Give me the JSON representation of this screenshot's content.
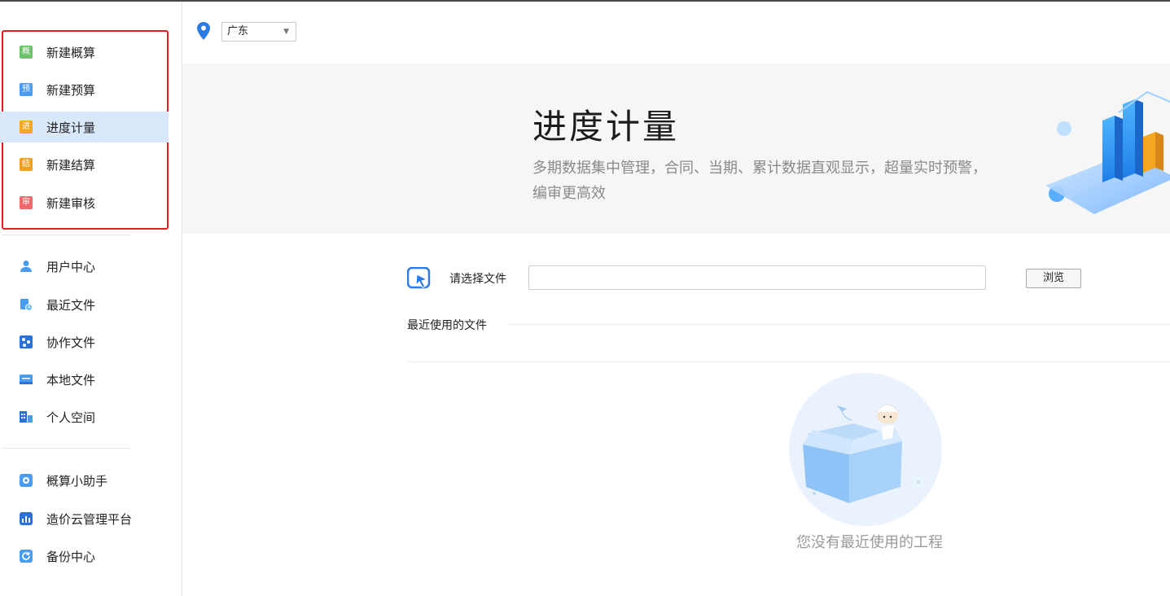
{
  "sidebar": {
    "top_items": [
      {
        "label": "新建概算",
        "icon": "概",
        "icon_name": "estimate-icon",
        "color": "#6cc26b"
      },
      {
        "label": "新建预算",
        "icon": "预",
        "icon_name": "budget-icon",
        "color": "#4a9cf0"
      },
      {
        "label": "进度计量",
        "icon": "进",
        "icon_name": "progress-icon",
        "color": "#f5a623",
        "active": true
      },
      {
        "label": "新建结算",
        "icon": "结",
        "icon_name": "settlement-icon",
        "color": "#f0a020"
      },
      {
        "label": "新建审核",
        "icon": "审",
        "icon_name": "audit-icon",
        "color": "#f06a6a"
      }
    ],
    "mid_items": [
      {
        "label": "用户中心",
        "icon_name": "user-icon"
      },
      {
        "label": "最近文件",
        "icon_name": "recent-files-icon"
      },
      {
        "label": "协作文件",
        "icon_name": "collab-files-icon"
      },
      {
        "label": "本地文件",
        "icon_name": "local-files-icon"
      },
      {
        "label": "个人空间",
        "icon_name": "personal-space-icon"
      }
    ],
    "bottom_items": [
      {
        "label": "概算小助手",
        "icon_name": "assistant-icon"
      },
      {
        "label": "造价云管理平台",
        "icon_name": "cloud-platform-icon"
      },
      {
        "label": "备份中心",
        "icon_name": "backup-icon"
      }
    ],
    "highlight_color": "#e02020",
    "active_bg": "#d9e8fb"
  },
  "header": {
    "region": "广东"
  },
  "banner": {
    "title": "进度计量",
    "description": "多期数据集中管理，合同、当期、累计数据直观显示，超量实时预警，编审更高效"
  },
  "file_picker": {
    "label": "请选择文件",
    "value": "",
    "browse_label": "浏览"
  },
  "recent": {
    "title": "最近使用的文件",
    "empty_text": "您没有最近使用的工程"
  }
}
